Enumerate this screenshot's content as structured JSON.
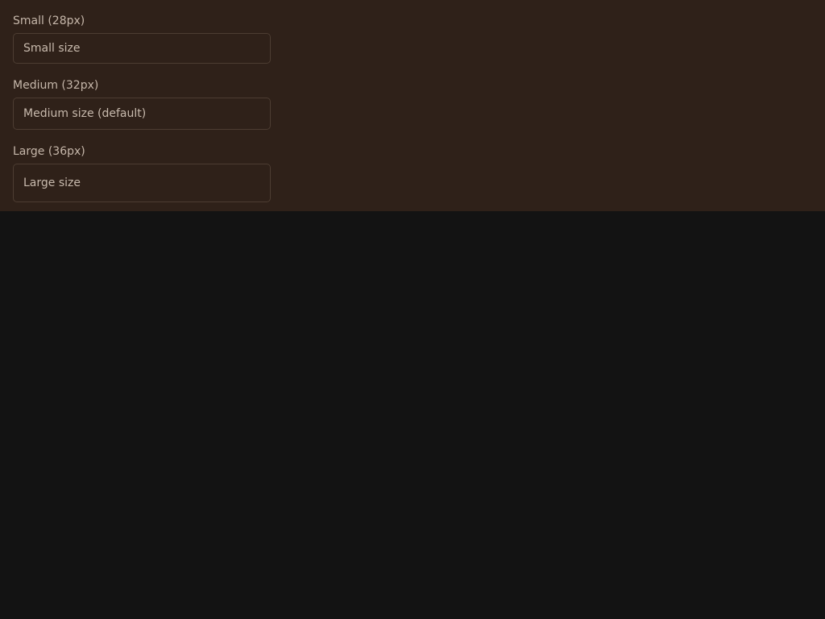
{
  "fields": [
    {
      "label": "Small (28px)",
      "placeholder": "Small size",
      "value": ""
    },
    {
      "label": "Medium (32px)",
      "placeholder": "Medium size (default)",
      "value": ""
    },
    {
      "label": "Large (36px)",
      "placeholder": "Large size",
      "value": ""
    }
  ],
  "colors": {
    "panel_background": "#2f2119",
    "page_background": "#131313",
    "label_text": "#c6b7aa",
    "input_border": "#4d3d32",
    "placeholder_text": "#c8baad"
  }
}
